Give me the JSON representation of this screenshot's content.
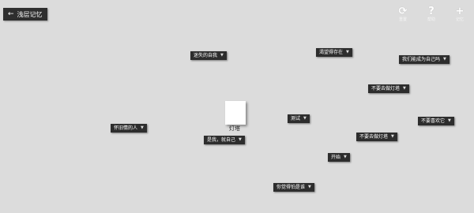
{
  "header": {
    "back_arrow": "←",
    "title": "浅层记忆"
  },
  "tools": [
    {
      "icon": "refresh-icon",
      "glyph": "⟳",
      "label": "重置"
    },
    {
      "icon": "help-icon",
      "glyph": "?",
      "label": "帮助"
    },
    {
      "icon": "add-icon",
      "glyph": "+",
      "label": "记忆"
    }
  ],
  "center": {
    "label": "灯塔"
  },
  "tags": [
    "迷失的自我",
    "渴望得存在",
    "我们能成为自己吗",
    "不要去做灯塔",
    "不要喜欢它",
    "怀旧情的人",
    "测试",
    "是我，就自己",
    "不要去做灯塔",
    "开始",
    "你觉得怕是谁"
  ],
  "dropdown_glyph": "▼"
}
